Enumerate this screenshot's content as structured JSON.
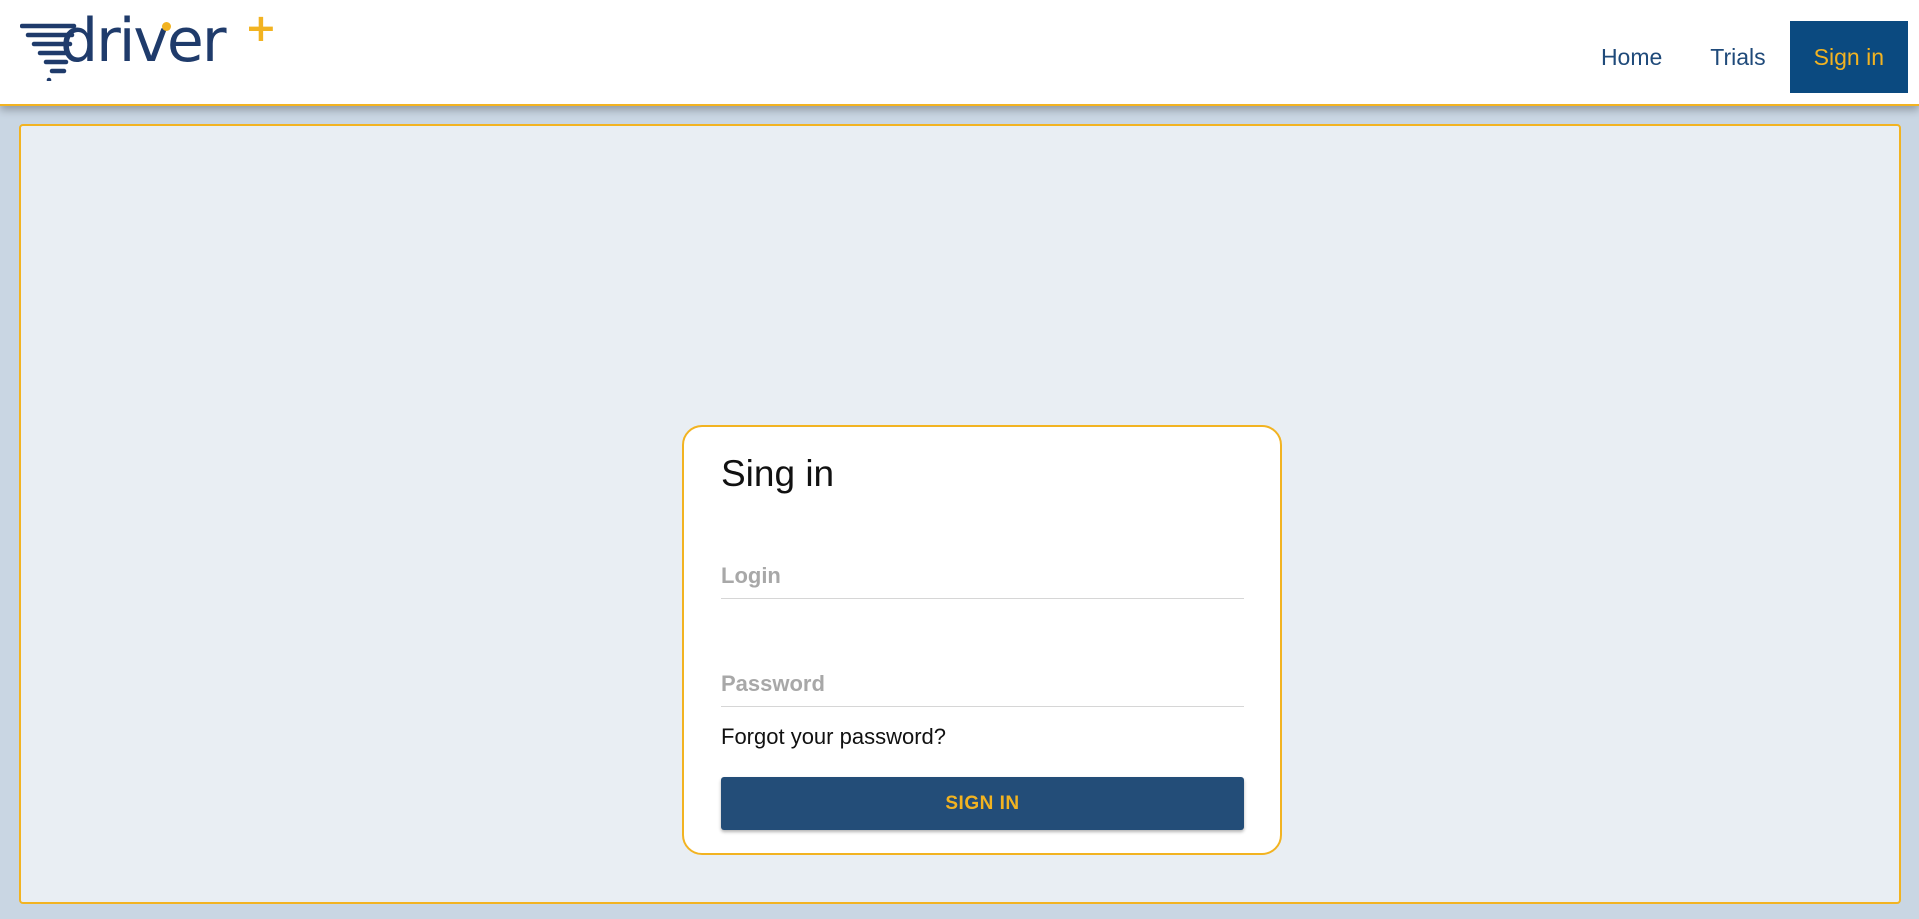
{
  "brand": {
    "logo_text": "driver",
    "logo_plus": "+",
    "colors": {
      "navy": "#1f3b6b",
      "accent": "#f2b321",
      "active_nav_bg": "#0b4a80",
      "button_bg": "#234d78"
    }
  },
  "nav": {
    "items": [
      {
        "label": "Home"
      },
      {
        "label": "Trials"
      },
      {
        "label": "Sign in",
        "active": true
      }
    ]
  },
  "signin_card": {
    "title": "Sing in",
    "login_placeholder": "Login",
    "password_placeholder": "Password",
    "forgot_label": "Forgot your password?",
    "submit_label": "SIGN IN"
  }
}
